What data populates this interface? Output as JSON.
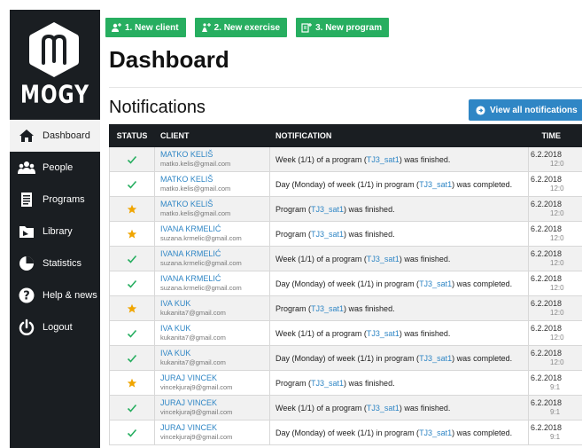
{
  "brand": {
    "name": "MOGY",
    "accent": "#27ae60",
    "link": "#2f86c5",
    "sidebar_bg": "#1a1e22"
  },
  "sidebar": {
    "items": [
      {
        "label": "Dashboard",
        "icon": "home-icon",
        "active": true
      },
      {
        "label": "People",
        "icon": "people-icon",
        "active": false
      },
      {
        "label": "Programs",
        "icon": "document-icon",
        "active": false
      },
      {
        "label": "Library",
        "icon": "folder-icon",
        "active": false
      },
      {
        "label": "Statistics",
        "icon": "pie-chart-icon",
        "active": false
      },
      {
        "label": "Help & news",
        "icon": "help-icon",
        "active": false
      },
      {
        "label": "Logout",
        "icon": "power-icon",
        "active": false
      }
    ]
  },
  "toolbar": {
    "new_client": "1. New client",
    "new_exercise": "2. New exercise",
    "new_program": "3. New program"
  },
  "page": {
    "title": "Dashboard",
    "section": "Notifications",
    "view_all": "View all notifications"
  },
  "table": {
    "headers": {
      "status": "STATUS",
      "client": "CLIENT",
      "notification": "NOTIFICATION",
      "time": "TIME"
    },
    "rows": [
      {
        "status": "check",
        "client": "MATKO KELIŠ",
        "email": "matko.kelis@gmail.com",
        "pre": "Week (1/1) of a program (",
        "program": "TJ3_sat1",
        "post": ") was finished.",
        "date": "6.2.2018",
        "time": "12:0"
      },
      {
        "status": "check",
        "client": "MATKO KELIŠ",
        "email": "matko.kelis@gmail.com",
        "pre": "Day (Monday) of week (1/1) in program (",
        "program": "TJ3_sat1",
        "post": ") was completed.",
        "date": "6.2.2018",
        "time": "12:0"
      },
      {
        "status": "star",
        "client": "MATKO KELIŠ",
        "email": "matko.kelis@gmail.com",
        "pre": "Program (",
        "program": "TJ3_sat1",
        "post": ") was finished.",
        "date": "6.2.2018",
        "time": "12:0"
      },
      {
        "status": "star",
        "client": "IVANA KRMELIĆ",
        "email": "suzana.krmelic@gmail.com",
        "pre": "Program (",
        "program": "TJ3_sat1",
        "post": ") was finished.",
        "date": "6.2.2018",
        "time": "12:0"
      },
      {
        "status": "check",
        "client": "IVANA KRMELIĆ",
        "email": "suzana.krmelic@gmail.com",
        "pre": "Week (1/1) of a program (",
        "program": "TJ3_sat1",
        "post": ") was finished.",
        "date": "6.2.2018",
        "time": "12:0"
      },
      {
        "status": "check",
        "client": "IVANA KRMELIĆ",
        "email": "suzana.krmelic@gmail.com",
        "pre": "Day (Monday) of week (1/1) in program (",
        "program": "TJ3_sat1",
        "post": ") was completed.",
        "date": "6.2.2018",
        "time": "12:0"
      },
      {
        "status": "star",
        "client": "IVA KUK",
        "email": "kukanita7@gmail.com",
        "pre": "Program (",
        "program": "TJ3_sat1",
        "post": ") was finished.",
        "date": "6.2.2018",
        "time": "12:0"
      },
      {
        "status": "check",
        "client": "IVA KUK",
        "email": "kukanita7@gmail.com",
        "pre": "Week (1/1) of a program (",
        "program": "TJ3_sat1",
        "post": ") was finished.",
        "date": "6.2.2018",
        "time": "12:0"
      },
      {
        "status": "check",
        "client": "IVA KUK",
        "email": "kukanita7@gmail.com",
        "pre": "Day (Monday) of week (1/1) in program (",
        "program": "TJ3_sat1",
        "post": ") was completed.",
        "date": "6.2.2018",
        "time": "12:0"
      },
      {
        "status": "star",
        "client": "JURAJ VINCEK",
        "email": "vincekjuraj9@gmail.com",
        "pre": "Program (",
        "program": "TJ3_sat1",
        "post": ") was finished.",
        "date": "6.2.2018",
        "time": "9:1"
      },
      {
        "status": "check",
        "client": "JURAJ VINCEK",
        "email": "vincekjuraj9@gmail.com",
        "pre": "Week (1/1) of a program (",
        "program": "TJ3_sat1",
        "post": ") was finished.",
        "date": "6.2.2018",
        "time": "9:1"
      },
      {
        "status": "check",
        "client": "JURAJ VINCEK",
        "email": "vincekjuraj9@gmail.com",
        "pre": "Day (Monday) of week (1/1) in program (",
        "program": "TJ3_sat1",
        "post": ") was completed.",
        "date": "6.2.2018",
        "time": "9:1"
      }
    ]
  },
  "status_colors": {
    "check": "#27ae60",
    "star": "#f0a500"
  }
}
